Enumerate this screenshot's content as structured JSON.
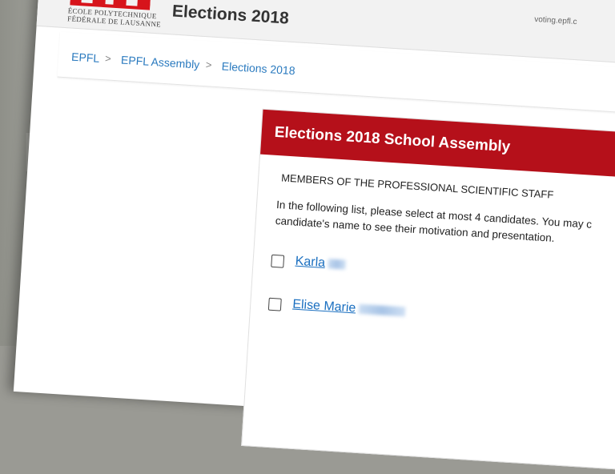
{
  "browser": {
    "url_fragment": "voting.epfl.c"
  },
  "header": {
    "logo": {
      "line1": "ÉCOLE POLYTECHNIQUE",
      "line2": "FÉDÉRALE DE LAUSANNE"
    },
    "site_title": "Elections 2018"
  },
  "breadcrumb": {
    "items": [
      "EPFL",
      "EPFL Assembly",
      "Elections 2018"
    ],
    "separator": ">"
  },
  "ballot": {
    "title": "Elections 2018 School Assembly",
    "section": "MEMBERS OF THE PROFESSIONAL SCIENTIFIC STAFF",
    "intro_line1": "In the following list, please select at most 4 candidates. You may c",
    "intro_line2": "candidate's name to see their motivation and presentation.",
    "candidates": [
      {
        "name": "Karla",
        "checked": false
      },
      {
        "name": "Elise Marie",
        "checked": false
      }
    ]
  },
  "colors": {
    "brand_red": "#b5101a",
    "link_blue": "#2a7abf"
  }
}
